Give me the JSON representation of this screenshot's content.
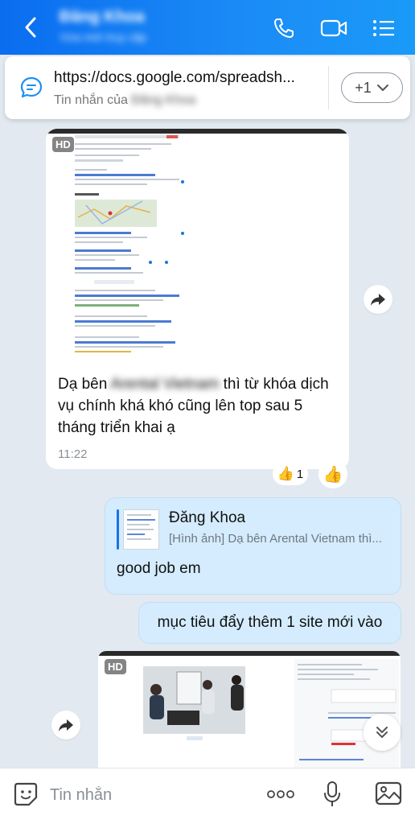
{
  "header": {
    "title": "Đăng Khoa",
    "subtitle": "Vừa mới truy cập"
  },
  "pinned": {
    "url": "https://docs.google.com/spreadsh...",
    "from_prefix": "Tin nhắn của ",
    "from_name": "Đăng Khoa",
    "more_count": "+1"
  },
  "messages": {
    "incoming": {
      "hd": "HD",
      "text_a": "Dạ bên ",
      "text_blur": "Arental Vietnam",
      "text_b": " thì từ khóa dịch vụ chính khá khó cũng lên top sau 5 tháng triển khai ạ",
      "time": "11:22",
      "reaction_count": "1"
    },
    "quote": {
      "name": "Đăng Khoa",
      "snippet": "[Hình ảnh] Dạ bên Arental Vietnam thì...",
      "reply": "good job em"
    },
    "outgoing2": "mục tiêu đẩy thêm 1 site mới vào",
    "image2_hd": "HD"
  },
  "composer": {
    "placeholder": "Tin nhắn"
  },
  "colors": {
    "header_start": "#0a6df0",
    "header_end": "#1a9af8",
    "outgoing_bubble": "#d4ecfd",
    "chat_bg": "#e2e9f1"
  }
}
